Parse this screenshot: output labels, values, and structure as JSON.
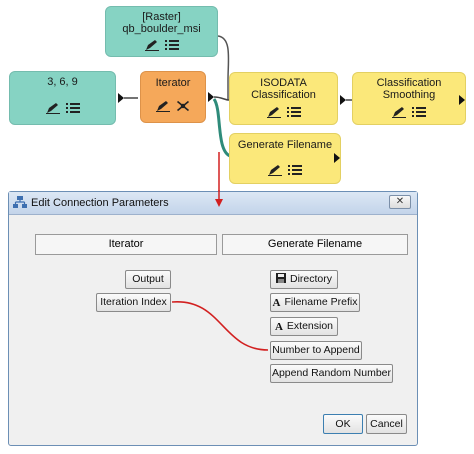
{
  "workflow": {
    "nodes": {
      "raster": {
        "title_line1": "[Raster]",
        "title_line2": "qb_boulder_msi"
      },
      "list": {
        "title": "3, 6, 9"
      },
      "iterator": {
        "title": "Iterator"
      },
      "isodata": {
        "title_line1": "ISODATA",
        "title_line2": "Classification"
      },
      "smoothing": {
        "title_line1": "Classification",
        "title_line2": "Smoothing"
      },
      "generate": {
        "title": "Generate Filename"
      }
    },
    "colors": {
      "input_node": "#86d3c3",
      "iterator_node": "#f5a85a",
      "task_node": "#fbe87a",
      "link": "#444444",
      "active_link": "#2e8b7a",
      "arrow": "#d22020"
    }
  },
  "dialog": {
    "title": "Edit Connection Parameters",
    "close_label": "✕",
    "left_header": "Iterator",
    "right_header": "Generate Filename",
    "outputs": [
      {
        "label": "Output"
      },
      {
        "label": "Iteration Index"
      }
    ],
    "inputs": [
      {
        "label": "Directory",
        "icon": "save-icon"
      },
      {
        "label": "Filename Prefix",
        "icon": "font-a-icon"
      },
      {
        "label": "Extension",
        "icon": "font-a-icon"
      },
      {
        "label": "Number to Append",
        "icon": ""
      },
      {
        "label": "Append Random Number",
        "icon": ""
      }
    ],
    "ok_label": "OK",
    "cancel_label": "Cancel"
  }
}
